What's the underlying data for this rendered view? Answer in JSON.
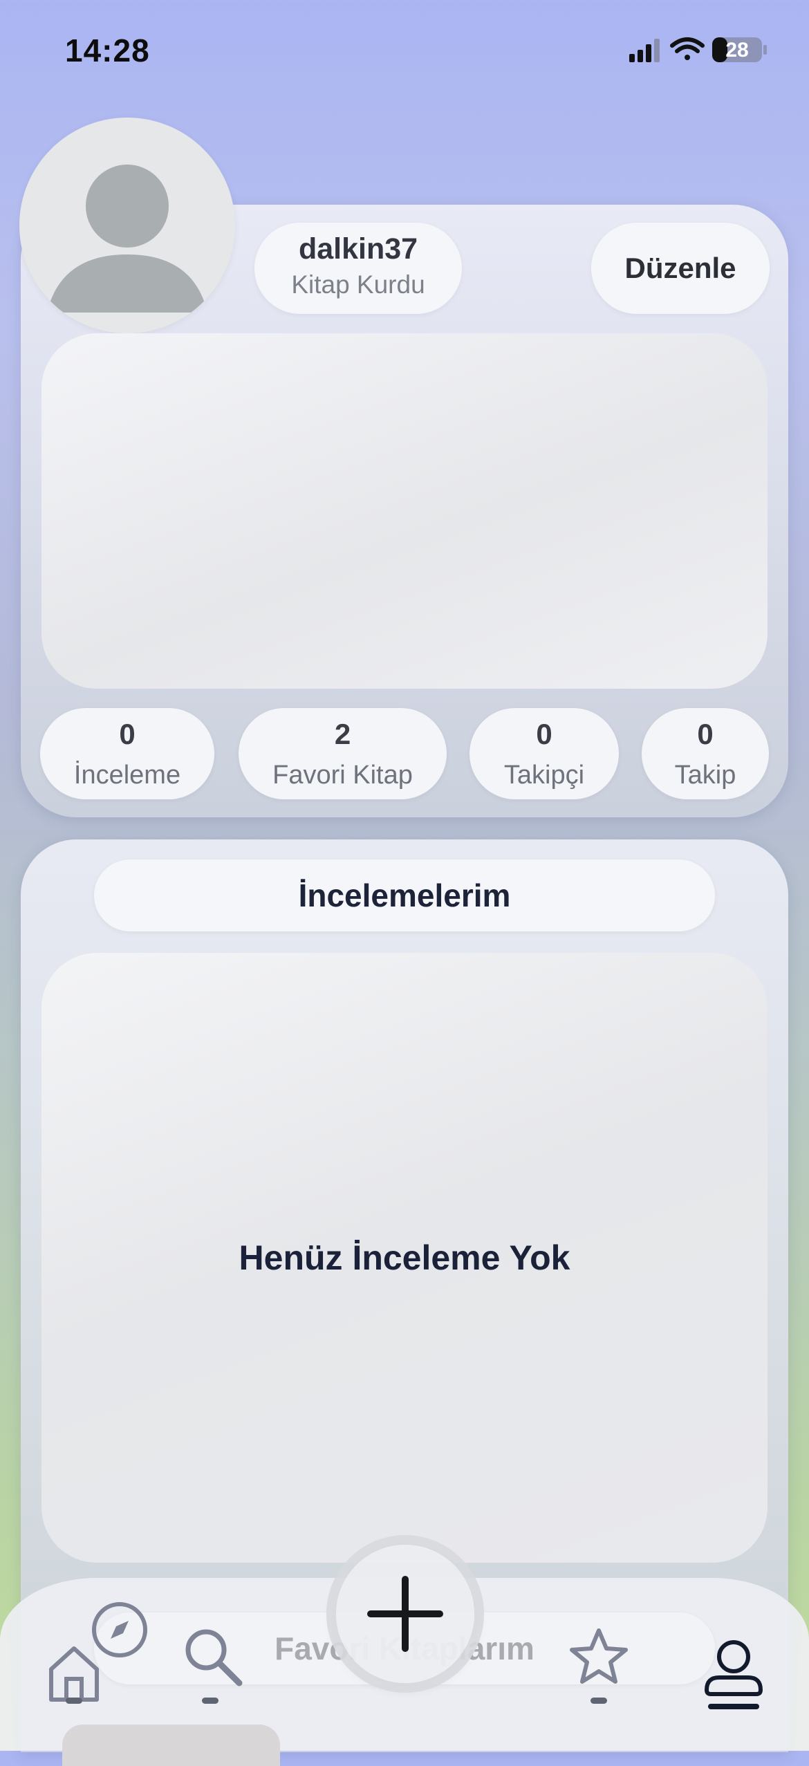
{
  "status_bar": {
    "time": "14:28",
    "battery": "28"
  },
  "profile": {
    "username": "dalkin37",
    "rank": "Kitap Kurdu",
    "edit_label": "Düzenle",
    "stats": [
      {
        "value": "0",
        "label": "İnceleme"
      },
      {
        "value": "2",
        "label": "Favori Kitap"
      },
      {
        "value": "0",
        "label": "Takipçi"
      },
      {
        "value": "0",
        "label": "Takip"
      }
    ]
  },
  "reviews": {
    "title": "İncelemelerim",
    "empty_text": "Henüz İnceleme Yok"
  },
  "favorites": {
    "title": "Favori Kitaplarım"
  },
  "tab_bar": {
    "tabs": [
      "home-icon",
      "compass-icon",
      "search-icon",
      "add-icon",
      "star-icon",
      "profile-icon"
    ],
    "active": "profile-icon"
  }
}
